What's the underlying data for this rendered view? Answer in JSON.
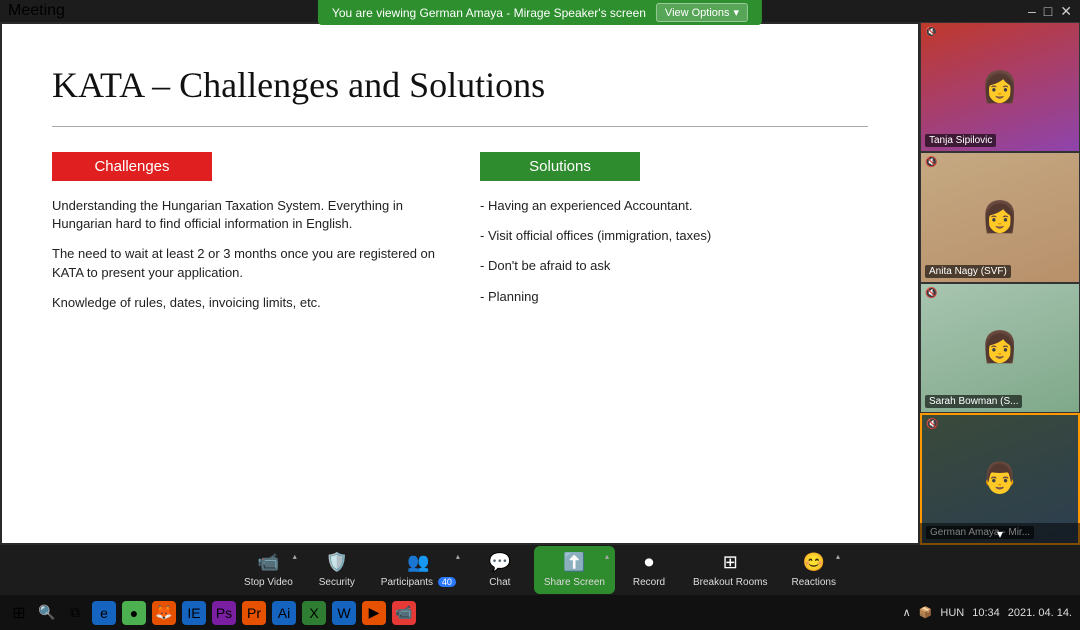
{
  "titlebar": {
    "title": "Meeting",
    "minimize": "–",
    "maximize": "□",
    "close": "✕"
  },
  "banner": {
    "text": "You are viewing German Amaya - Mirage Speaker's screen",
    "button": "View Options",
    "caret": "▾"
  },
  "slide": {
    "title": "KATA – Challenges and Solutions",
    "challenges_header": "Challenges",
    "solutions_header": "Solutions",
    "challenges": [
      "Understanding the Hungarian Taxation System. Everything in Hungarian hard to find official information in English.",
      "The need to wait at least 2 or 3 months once you are registered on KATA to present your application.",
      "Knowledge of rules, dates, invoicing limits, etc."
    ],
    "solutions": [
      "Having an experienced Accountant.",
      "Visit official offices (immigration, taxes)",
      "Don't be afraid to ask",
      "Planning"
    ]
  },
  "participants": [
    {
      "name": "Tanja Sipilovic",
      "color1": "#c0392b",
      "color2": "#8e44ad",
      "emoji": "👩"
    },
    {
      "name": "Anita Nagy (SVF)",
      "color1": "#f5cba7",
      "color2": "#d4a276",
      "emoji": "👩"
    },
    {
      "name": "Sarah Bowman (S...",
      "color1": "#a8c5b0",
      "color2": "#7fa88a",
      "emoji": "👩"
    },
    {
      "name": "German Amaya - Mir...",
      "color1": "#2c3e50",
      "color2": "#4a5568",
      "emoji": "👨",
      "active": true
    }
  ],
  "toolbar": {
    "stop_video": "Stop Video",
    "security": "Security",
    "participants_label": "Participants",
    "participants_count": "40",
    "chat": "Chat",
    "share_screen": "Share Screen",
    "record": "Record",
    "breakout_rooms": "Breakout Rooms",
    "reactions": "Reactions"
  },
  "taskbar": {
    "time": "10:34",
    "date": "2021. 04. 14.",
    "lang": "HUN",
    "search_placeholder": "Search"
  }
}
